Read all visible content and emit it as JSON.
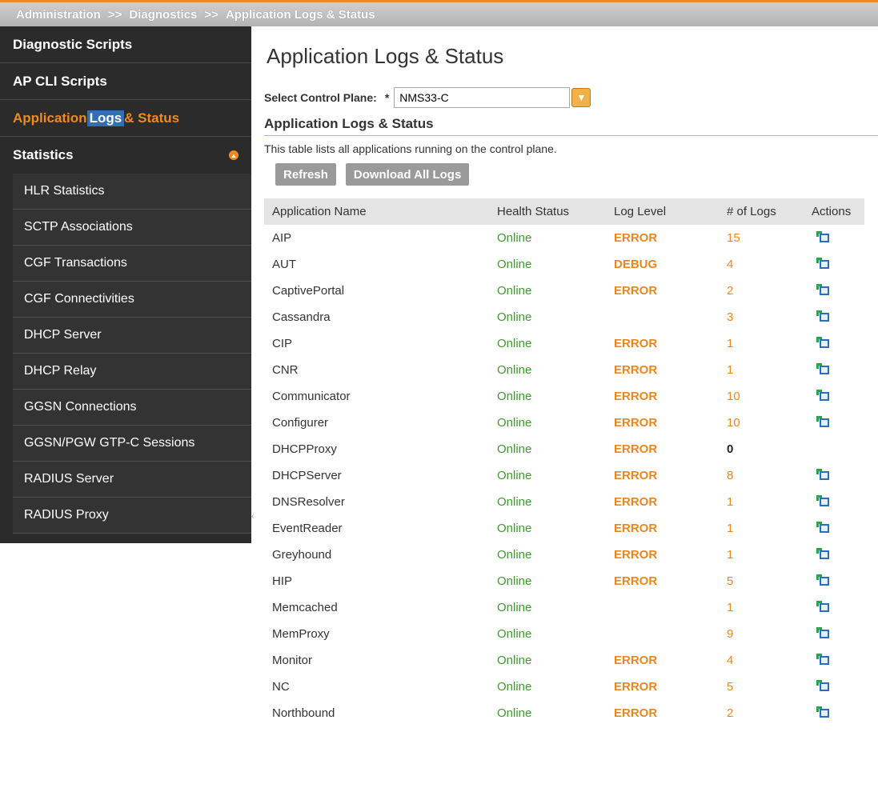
{
  "breadcrumb": [
    "Administration",
    "Diagnostics",
    "Application Logs & Status"
  ],
  "breadcrumb_separator": ">>",
  "sidebar": {
    "items": [
      {
        "label": "Diagnostic Scripts"
      },
      {
        "label": "AP CLI Scripts"
      },
      {
        "label_pre": "Application ",
        "label_hl": "Logs",
        "label_post": " & Status"
      },
      {
        "label": "Statistics"
      }
    ],
    "stats_items": [
      "HLR Statistics",
      "SCTP Associations",
      "CGF Transactions",
      "CGF Connectivities",
      "DHCP Server",
      "DHCP Relay",
      "GGSN Connections",
      "GGSN/PGW GTP-C Sessions",
      "RADIUS Server",
      "RADIUS Proxy"
    ]
  },
  "main": {
    "title": "Application Logs & Status",
    "control_plane_label": "Select Control Plane:",
    "required_marker": "*",
    "control_plane_value": "NMS33-C",
    "section_title": "Application Logs & Status",
    "description": "This table lists all applications running on the control plane.",
    "refresh_label": "Refresh",
    "download_label": "Download All Logs"
  },
  "table": {
    "columns": [
      "Application Name",
      "Health Status",
      "Log Level",
      "# of Logs",
      "Actions"
    ],
    "rows": [
      {
        "name": "AIP",
        "status": "Online",
        "level": "ERROR",
        "logs": "15"
      },
      {
        "name": "AUT",
        "status": "Online",
        "level": "DEBUG",
        "logs": "4"
      },
      {
        "name": "CaptivePortal",
        "status": "Online",
        "level": "ERROR",
        "logs": "2"
      },
      {
        "name": "Cassandra",
        "status": "Online",
        "level": "",
        "logs": "3"
      },
      {
        "name": "CIP",
        "status": "Online",
        "level": "ERROR",
        "logs": "1"
      },
      {
        "name": "CNR",
        "status": "Online",
        "level": "ERROR",
        "logs": "1"
      },
      {
        "name": "Communicator",
        "status": "Online",
        "level": "ERROR",
        "logs": "10"
      },
      {
        "name": "Configurer",
        "status": "Online",
        "level": "ERROR",
        "logs": "10"
      },
      {
        "name": "DHCPProxy",
        "status": "Online",
        "level": "ERROR",
        "logs": "0"
      },
      {
        "name": "DHCPServer",
        "status": "Online",
        "level": "ERROR",
        "logs": "8"
      },
      {
        "name": "DNSResolver",
        "status": "Online",
        "level": "ERROR",
        "logs": "1"
      },
      {
        "name": "EventReader",
        "status": "Online",
        "level": "ERROR",
        "logs": "1"
      },
      {
        "name": "Greyhound",
        "status": "Online",
        "level": "ERROR",
        "logs": "1"
      },
      {
        "name": "HIP",
        "status": "Online",
        "level": "ERROR",
        "logs": "5"
      },
      {
        "name": "Memcached",
        "status": "Online",
        "level": "",
        "logs": "1"
      },
      {
        "name": "MemProxy",
        "status": "Online",
        "level": "",
        "logs": "9"
      },
      {
        "name": "Monitor",
        "status": "Online",
        "level": "ERROR",
        "logs": "4"
      },
      {
        "name": "NC",
        "status": "Online",
        "level": "ERROR",
        "logs": "5"
      },
      {
        "name": "Northbound",
        "status": "Online",
        "level": "ERROR",
        "logs": "2"
      }
    ]
  },
  "colors": {
    "accent": "#f08a1e",
    "online": "#3f9a2e",
    "sidebar_bg": "#2b2b2b"
  },
  "icons": {
    "action": "download-log-icon",
    "statistics_toggle": "collapse-icon",
    "dropdown": "chevron-down-icon"
  }
}
